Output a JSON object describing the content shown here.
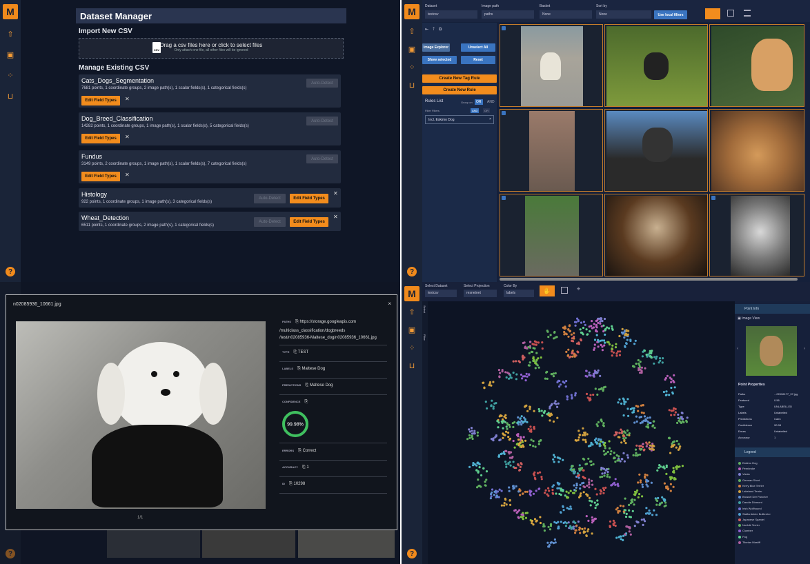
{
  "q1": {
    "title": "Dataset Manager",
    "import_heading": "Import New CSV",
    "drop_text": "Drag a csv files here or click to select files",
    "drop_sub": "Only attach one file, all other files will be ignored",
    "csv_icon": "CSV",
    "manage_heading": "Manage Existing CSV",
    "auto_detect": "Auto-Detect",
    "edit_field_types": "Edit Field Types",
    "close_glyph": "✕",
    "datasets": [
      {
        "name": "Cats_Dogs_Segmentation",
        "meta": "7681 points, 1 coordinate groups, 2 image path(s), 1 scalar fields(s), 1 categorical fields(s)"
      },
      {
        "name": "Dog_Breed_Classification",
        "meta": "14282 points, 1 coordinate groups, 1 image path(s), 1 scalar fields(s), 5 categorical fields(s)"
      },
      {
        "name": "Fundus",
        "meta": "3149 points, 2 coordinate groups, 1 image path(s), 1 scalar fields(s), 7 categorical fields(s)"
      },
      {
        "name": "Histology",
        "meta": "922 points, 1 coordinate groups, 1 image path(s), 3 categorical fields(s)"
      },
      {
        "name": "Wheat_Detection",
        "meta": "6511 points, 1 coordinate groups, 2 image path(s), 1 categorical fields(s)"
      }
    ]
  },
  "app": {
    "logo": "M",
    "help": "?"
  },
  "q2": {
    "dataset_label": "Dataset",
    "dataset_value": "testcsv",
    "image_path_label": "Image path",
    "image_path_value": "paths",
    "basket_label": "Basket",
    "basket_value": "None",
    "sort_label": "Sort by",
    "sort_value": "None",
    "use_local_filters": "Use local filters",
    "image_explorer": "Image Explorer",
    "unselect_all": "Unselect All",
    "show_selected": "Show selected",
    "reset": "Reset",
    "create_tag_rule": "Create New Tag Rule",
    "create_rule": "Create New Rule",
    "rules_list": "Rules List",
    "group_on": "Group on",
    "or": "OR",
    "and": "AND",
    "filter_label": "Filter Filters",
    "rule_item": "Incl. Eskimo Dog",
    "rule_close": "×"
  },
  "q3": {
    "filename": "n02085936_10661.jpg",
    "close": "×",
    "page": "1/1",
    "paths_label": "PATHS",
    "paths_value": "https://storage.googleapis.com",
    "paths_value2": "/multiclass_classification/dogbreeds",
    "paths_value3": "/test/n02085936-Maltese_dog/n02085936_10661.jpg",
    "type_label": "TYPE",
    "type_value": "TEST",
    "labels_label": "LABELS",
    "labels_value": "Maltese Dog",
    "pred_label": "PREDICTIONS",
    "pred_value": "Maltese Dog",
    "conf_label": "CONFIDENCE",
    "conf_value": "99.98%",
    "conf_fraction": 0.9998,
    "errors_label": "ERRORS",
    "errors_value": "Correct",
    "acc_label": "ACCURACY",
    "acc_value": "1",
    "id_label": "ID",
    "id_value": "10298",
    "copy_icon": "⎘"
  },
  "q4": {
    "select_dataset": "Select Dataset",
    "dataset_value": "testcsv",
    "select_projection": "Select Projection",
    "projection_value": "resnetnet",
    "color_by": "Color By",
    "color_value": "labels",
    "select_tab": "Select",
    "filter_tab": "Filter",
    "point_info": "Point Info",
    "image_view": "Image View",
    "point_props": "Point Properties",
    "props": [
      {
        "k": "Paths",
        "v": "...02096177_97.jpg"
      },
      {
        "k": "Featured",
        "v": "0.56"
      },
      {
        "k": "Type",
        "v": "UNLABELLED"
      },
      {
        "k": "Labels",
        "v": "Unlabelled"
      },
      {
        "k": "Predictions",
        "v": "Cairn"
      },
      {
        "k": "Confidence",
        "v": "90.98"
      },
      {
        "k": "Errors",
        "v": "Unlabelled"
      },
      {
        "k": "Accuracy",
        "v": "1"
      }
    ],
    "legend_title": "Legend",
    "legend": [
      {
        "name": "Eskimo Dog",
        "color": "#5fae5f"
      },
      {
        "name": "Pembroke",
        "color": "#b85fb8"
      },
      {
        "name": "Vizsla",
        "color": "#7f7fcf"
      },
      {
        "name": "German Short",
        "color": "#5fae5f"
      },
      {
        "name": "Kerry Blue Terrier",
        "color": "#cf7f3f"
      },
      {
        "name": "Lakeland Terrier",
        "color": "#cfa03f"
      },
      {
        "name": "Brussel Der Pancher",
        "color": "#5f8fcf"
      },
      {
        "name": "Dandie Dinmont",
        "color": "#3fa0a0"
      },
      {
        "name": "Irish Wolfhound",
        "color": "#6f6fcf"
      },
      {
        "name": "Staffordshire Bullterrier",
        "color": "#4f9fcf"
      },
      {
        "name": "Japanese Spaniel",
        "color": "#cf5f5f"
      },
      {
        "name": "Norfolk Terrier",
        "color": "#5faf5f"
      },
      {
        "name": "Clumber",
        "color": "#8f5fcf"
      },
      {
        "name": "Pug",
        "color": "#5fcf8f"
      },
      {
        "name": "Tibetan Mastiff",
        "color": "#af5f9f"
      }
    ]
  }
}
